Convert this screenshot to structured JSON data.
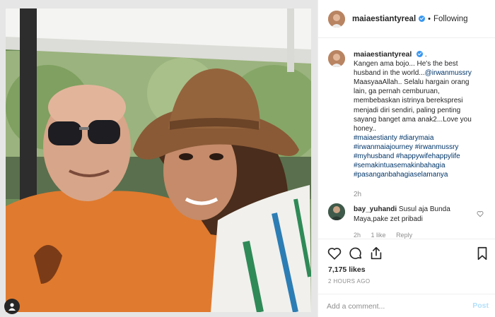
{
  "header": {
    "username": "maiaestiantyreal",
    "separator": "•",
    "follow_status": "Following"
  },
  "caption": {
    "username": "maiaestiantyreal",
    "after_badge": ".",
    "lines": [
      "Kangen ama bojo... He's the best",
      "husband in the world...",
      "MaasyaaAllah.. Selalu hargain orang",
      "lain, ga pernah cemburuan,",
      "membebaskan istrinya berekspresi",
      "menjadi diri sendiri, paling penting",
      "sayang banget ama anak2...Love you",
      "honey.."
    ],
    "mention": "@irwanmussry",
    "hashtags": [
      "#maiaestianty",
      "#diarymaia",
      "#irwanmaiajourney",
      "#irwanmussry",
      "#myhusband",
      "#happywifehappylife",
      "#semakintuasemakinbahagia",
      "#pasanganbahagiaselamanya"
    ],
    "time": "2h"
  },
  "comment": {
    "username": "bay_yuhandi",
    "text_line1": "Susul aja Bunda",
    "text_line2": "Maya,pake zet pribadi",
    "time": "2h",
    "likes": "1 like",
    "reply": "Reply"
  },
  "post": {
    "likes": "7,175 likes",
    "posted": "2 HOURS AGO"
  },
  "add_comment": {
    "placeholder": "Add a comment...",
    "post_label": "Post"
  },
  "colors": {
    "link": "#003569",
    "verified": "#3897f0",
    "post_disabled": "#b2dffc"
  },
  "icons": [
    "verified-badge-icon",
    "heart-icon",
    "comment-icon",
    "share-icon",
    "bookmark-icon"
  ]
}
